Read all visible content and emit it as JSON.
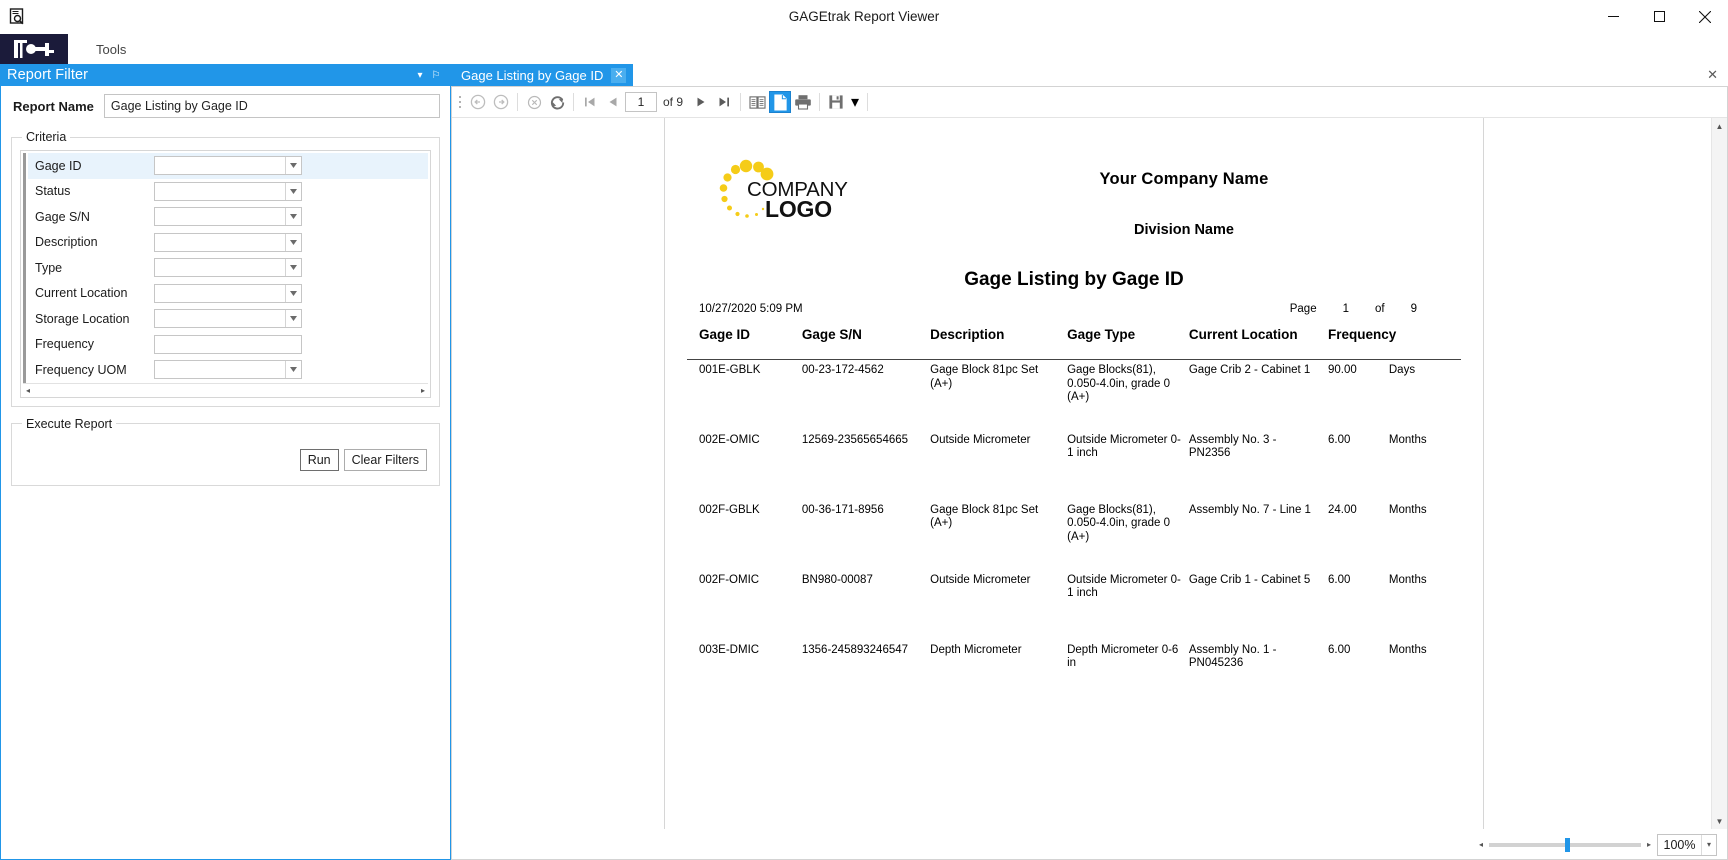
{
  "window": {
    "title": "GAGEtrak Report Viewer",
    "minimize_label": "─",
    "maximize_label": "□",
    "close_label": "✕"
  },
  "ribbon": {
    "menu_items": [
      {
        "label": "Tools"
      }
    ]
  },
  "report_filter": {
    "panel_title": "Report Filter",
    "dropdown_glyph": "▾",
    "pin_glyph": "⚐",
    "report_name_label": "Report Name",
    "report_name_value": "Gage Listing by Gage ID",
    "criteria_legend": "Criteria",
    "criteria": [
      {
        "label": "Gage ID",
        "value": "",
        "has_dropdown": true,
        "selected": true
      },
      {
        "label": "Status",
        "value": "",
        "has_dropdown": true,
        "selected": false
      },
      {
        "label": "Gage S/N",
        "value": "",
        "has_dropdown": true,
        "selected": false
      },
      {
        "label": "Description",
        "value": "",
        "has_dropdown": true,
        "selected": false
      },
      {
        "label": "Type",
        "value": "",
        "has_dropdown": true,
        "selected": false
      },
      {
        "label": "Current Location",
        "value": "",
        "has_dropdown": true,
        "selected": false
      },
      {
        "label": "Storage Location",
        "value": "",
        "has_dropdown": true,
        "selected": false
      },
      {
        "label": "Frequency",
        "value": "",
        "has_dropdown": false,
        "selected": false
      },
      {
        "label": "Frequency UOM",
        "value": "",
        "has_dropdown": true,
        "selected": false
      }
    ],
    "execute_legend": "Execute Report",
    "run_label": "Run",
    "clear_filters_label": "Clear Filters"
  },
  "document_tab": {
    "label": "Gage Listing by Gage ID",
    "close_glyph": "✕",
    "strip_close_glyph": "✕"
  },
  "viewer_toolbar": {
    "back_icon": "back-arrow-icon",
    "forward_icon": "forward-arrow-icon",
    "stop_icon": "stop-icon",
    "refresh_icon": "refresh-icon",
    "first_page_icon": "first-page-icon",
    "prev_page_icon": "previous-page-icon",
    "page_number": "1",
    "page_of_text": "of 9",
    "next_page_icon": "next-page-icon",
    "last_page_icon": "last-page-icon",
    "multipage_icon": "multipage-view-icon",
    "singlepage_icon": "single-page-view-icon",
    "print_icon": "print-icon",
    "save_icon": "save-icon",
    "save_dropdown_glyph": "▾"
  },
  "report": {
    "logo_text_line1": "COMPANY",
    "logo_text_line2": "LOGO",
    "company_name": "Your Company Name",
    "division_name": "Division Name",
    "title": "Gage Listing by Gage ID",
    "timestamp": "10/27/2020 5:09 PM",
    "page_label": "Page",
    "page_number": "1",
    "page_of_label": "of",
    "page_total": "9",
    "columns": [
      "Gage ID",
      "Gage S/N",
      "Description",
      "Gage Type",
      "Current Location",
      "Frequency",
      ""
    ],
    "rows": [
      {
        "gage_id": "001E-GBLK",
        "gage_sn": "00-23-172-4562",
        "description": "Gage Block  81pc Set (A+)",
        "gage_type": "Gage Blocks(81), 0.050-4.0in, grade 0 (A+)",
        "current_location": "Gage Crib 2 - Cabinet 1",
        "frequency": "90.00",
        "frequency_uom": "Days"
      },
      {
        "gage_id": "002E-OMIC",
        "gage_sn": "12569-23565654665",
        "description": "Outside Micrometer",
        "gage_type": "Outside Micrometer 0-1 inch",
        "current_location": "Assembly No. 3 - PN2356",
        "frequency": "6.00",
        "frequency_uom": "Months"
      },
      {
        "gage_id": "002F-GBLK",
        "gage_sn": "00-36-171-8956",
        "description": "Gage Block  81pc Set (A+)",
        "gage_type": "Gage Blocks(81), 0.050-4.0in, grade 0 (A+)",
        "current_location": "Assembly No. 7 - Line 1",
        "frequency": "24.00",
        "frequency_uom": "Months"
      },
      {
        "gage_id": "002F-OMIC",
        "gage_sn": "BN980-00087",
        "description": "Outside Micrometer",
        "gage_type": "Outside Micrometer 0-1 inch",
        "current_location": "Gage Crib 1 - Cabinet 5",
        "frequency": "6.00",
        "frequency_uom": "Months"
      },
      {
        "gage_id": "003E-DMIC",
        "gage_sn": "1356-245893246547",
        "description": "Depth Micrometer",
        "gage_type": "Depth Micrometer 0-6 in",
        "current_location": "Assembly No. 1 - PN045236",
        "frequency": "6.00",
        "frequency_uom": "Months"
      }
    ]
  },
  "statusbar": {
    "zoom_value": "100%",
    "zoom_dropdown_glyph": "▾",
    "slider_left_glyph": "◂",
    "slider_right_glyph": "▸"
  },
  "colors": {
    "accent": "#2196e8",
    "ribbon_logo_bg": "#1b1b3a",
    "logo_yellow": "#f5cc18",
    "selected_row": "#e8f3fc"
  }
}
